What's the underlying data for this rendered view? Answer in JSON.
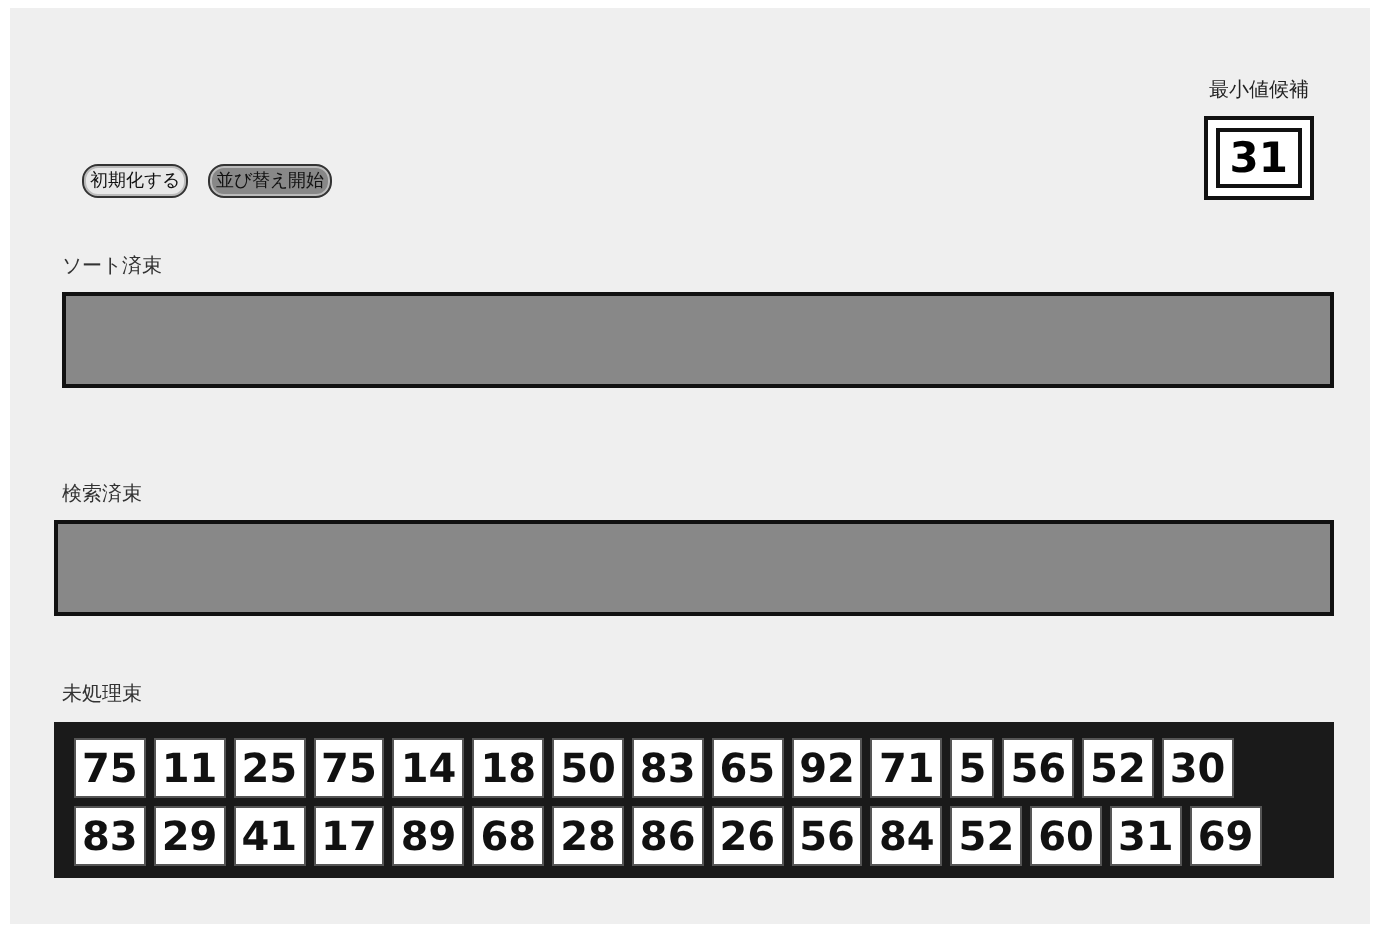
{
  "buttons": [
    {
      "label": "初期化する",
      "kind": "light"
    },
    {
      "label": "並び替え開始",
      "kind": "dark"
    }
  ],
  "min_candidate": {
    "label": "最小値候補",
    "value": "31"
  },
  "sorted": {
    "label": "ソート済束"
  },
  "searched": {
    "label": "検索済束"
  },
  "unprocessed": {
    "label": "未処理束",
    "rows": [
      [
        "75",
        "11",
        "25",
        "75",
        "14",
        "18",
        "50",
        "83",
        "65",
        "92",
        "71",
        "5",
        "56",
        "52",
        "30"
      ],
      [
        "83",
        "29",
        "41",
        "17",
        "89",
        "68",
        "28",
        "86",
        "26",
        "56",
        "84",
        "52",
        "60",
        "31",
        "69"
      ]
    ]
  }
}
